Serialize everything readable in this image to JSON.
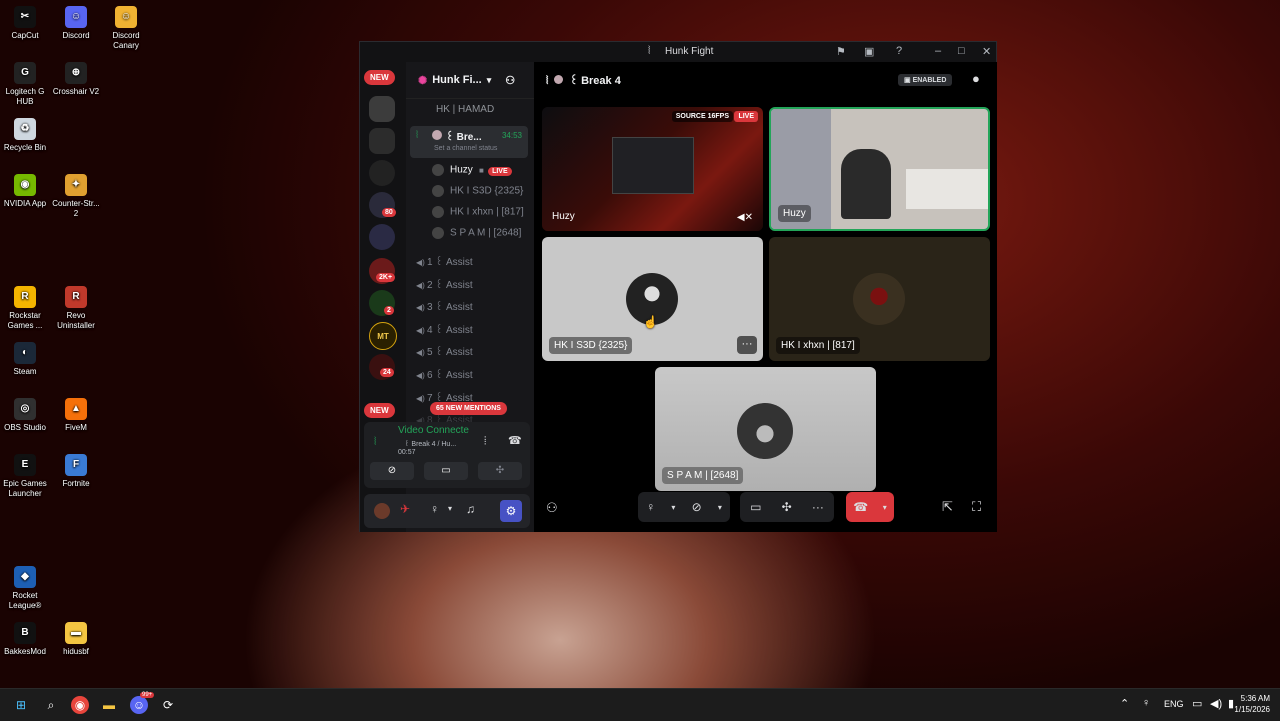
{
  "desktop": {
    "icons": [
      {
        "label": "CapCut",
        "icon": "capcut-icon",
        "color": "#111111",
        "glyph": "✂"
      },
      {
        "label": "Discord",
        "icon": "discord-icon",
        "color": "#5865f2",
        "glyph": "☺"
      },
      {
        "label": "Discord Canary",
        "icon": "discord-canary-icon",
        "color": "#f0b232",
        "glyph": "☺"
      },
      {
        "label": "Logitech G HUB",
        "icon": "logitech-icon",
        "color": "#222222",
        "glyph": "G"
      },
      {
        "label": "Crosshair V2",
        "icon": "crosshair-icon",
        "color": "#222222",
        "glyph": "⊕"
      },
      {
        "label": "Recycle Bin",
        "icon": "recycle-bin-icon",
        "color": "#cfd8e0",
        "glyph": "♻"
      },
      {
        "label": "NVIDIA App",
        "icon": "nvidia-icon",
        "color": "#76b900",
        "glyph": "◉"
      },
      {
        "label": "Counter-Str... 2",
        "icon": "cs2-icon",
        "color": "#e0a030",
        "glyph": "✦"
      },
      {
        "label": "Rockstar Games ...",
        "icon": "rockstar-icon",
        "color": "#f4b400",
        "glyph": "R"
      },
      {
        "label": "Revo Uninstaller",
        "icon": "revo-icon",
        "color": "#c0392b",
        "glyph": "R"
      },
      {
        "label": "Steam",
        "icon": "steam-icon",
        "color": "#1b2838",
        "glyph": "◐"
      },
      {
        "label": "OBS Studio",
        "icon": "obs-icon",
        "color": "#303030",
        "glyph": "◎"
      },
      {
        "label": "FiveM",
        "icon": "fivem-icon",
        "color": "#f5700a",
        "glyph": "▲"
      },
      {
        "label": "Epic Games Launcher",
        "icon": "epic-icon",
        "color": "#111111",
        "glyph": "E"
      },
      {
        "label": "Fortnite",
        "icon": "fortnite-icon",
        "color": "#3a7bd5",
        "glyph": "F"
      },
      {
        "label": "Rocket League®",
        "icon": "rocket-league-icon",
        "color": "#1d5fb4",
        "glyph": "◆"
      },
      {
        "label": "BakkesMod",
        "icon": "bakkesmod-icon",
        "color": "#111111",
        "glyph": "B"
      },
      {
        "label": "hidusbf",
        "icon": "folder-icon",
        "color": "#f4c542",
        "glyph": "▬"
      }
    ]
  },
  "window": {
    "title": "Hunk Fight"
  },
  "servers": {
    "new_top": "NEW",
    "new_bottom": "NEW",
    "badges": [
      "80",
      "2K+",
      "2",
      "24"
    ],
    "mt_label": "MT"
  },
  "channels": {
    "server_name": "Hunk Fi...",
    "pinned_user": "HK | HAMAD",
    "active_channel": "꒰ Bre...",
    "active_time": "34:53",
    "status_placeholder": "Set a channel status",
    "voice_users": [
      {
        "name": "Huzy",
        "live": "LIVE"
      },
      {
        "name": "HK I S3D {2325}"
      },
      {
        "name": "HK I xhxn | [817]"
      },
      {
        "name": "S P A M | [2648]"
      }
    ],
    "assist_channels": [
      "1 ꒰ Assist",
      "2 ꒰ Assist",
      "3 ꒰ Assist",
      "4 ꒰ Assist",
      "5 ꒰ Assist",
      "6 ꒰ Assist",
      "7 ꒰ Assist",
      "8 ꒰ Assist"
    ],
    "mentions": "65 NEW MENTIONS"
  },
  "voice_panel": {
    "status": "Video Connecte",
    "channel": "꒰ Break 4 / Hu...",
    "timer": "00:57"
  },
  "main": {
    "channel_title": "꒰ Break 4",
    "enabled_label": "ENABLED",
    "tiles": [
      {
        "label": "Huzy",
        "badge_source": "SOURCE 16FPS",
        "badge_live": "LIVE"
      },
      {
        "label": "Huzy"
      },
      {
        "label": "HK I S3D {2325}"
      },
      {
        "label": "HK I xhxn | [817]"
      },
      {
        "label": "S P A M | [2648]"
      }
    ]
  },
  "taskbar": {
    "lang": "ENG",
    "time": "5:36 AM",
    "date": "1/15/2026",
    "discord_badge": "99+"
  }
}
